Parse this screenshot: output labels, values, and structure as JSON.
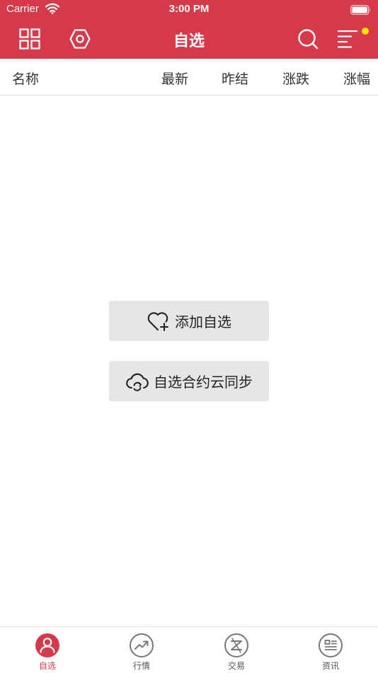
{
  "status_bar": {
    "carrier": "Carrier",
    "time": "3:00 PM"
  },
  "nav": {
    "title": "自选",
    "left_icons": [
      "grid-icon",
      "hexagon-settings-icon"
    ],
    "right_icons": [
      "search-icon",
      "menu-icon"
    ],
    "notification_dot_color": "#ffe600"
  },
  "columns": {
    "name": "名称",
    "latest": "最新",
    "prev_close": "昨结",
    "change": "涨跌",
    "change_pct": "涨幅"
  },
  "actions": {
    "add_label": "添加自选",
    "sync_label": "自选合约云同步"
  },
  "tabs": [
    {
      "label": "自选",
      "icon": "person-icon",
      "active": true
    },
    {
      "label": "行情",
      "icon": "trend-up-icon",
      "active": false
    },
    {
      "label": "交易",
      "icon": "trade-icon",
      "active": false
    },
    {
      "label": "资讯",
      "icon": "news-icon",
      "active": false
    }
  ],
  "colors": {
    "brand": "#d63a4a",
    "button_bg": "#e6e6e6"
  }
}
